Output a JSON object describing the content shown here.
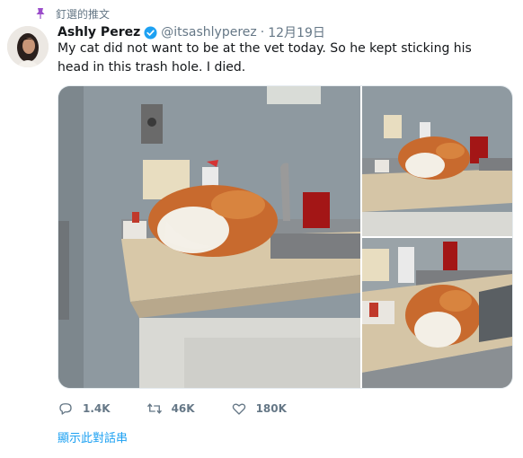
{
  "pinned": {
    "label": "釘選的推文",
    "icon": "pin-icon",
    "color": "#9b4dca"
  },
  "tweet": {
    "author_name": "Ashly Perez",
    "verified_icon": "verified-badge-icon",
    "handle": "@itsashlyperez",
    "separator": "·",
    "date": "12月19日",
    "text": "My cat did not want to be at the vet today. So he kept sticking his head in this trash hole. I died."
  },
  "media": {
    "photos": [
      "cat-photo-main",
      "cat-photo-top-right",
      "cat-photo-bottom-right"
    ]
  },
  "actions": {
    "reply": {
      "icon": "reply-icon",
      "count": "1.4K"
    },
    "retweet": {
      "icon": "retweet-icon",
      "count": "46K"
    },
    "like": {
      "icon": "heart-icon",
      "count": "180K"
    }
  },
  "thread_link": "顯示此對話串",
  "colors": {
    "accent": "#1da1f2",
    "muted": "#657786",
    "pin": "#9b4dca"
  }
}
